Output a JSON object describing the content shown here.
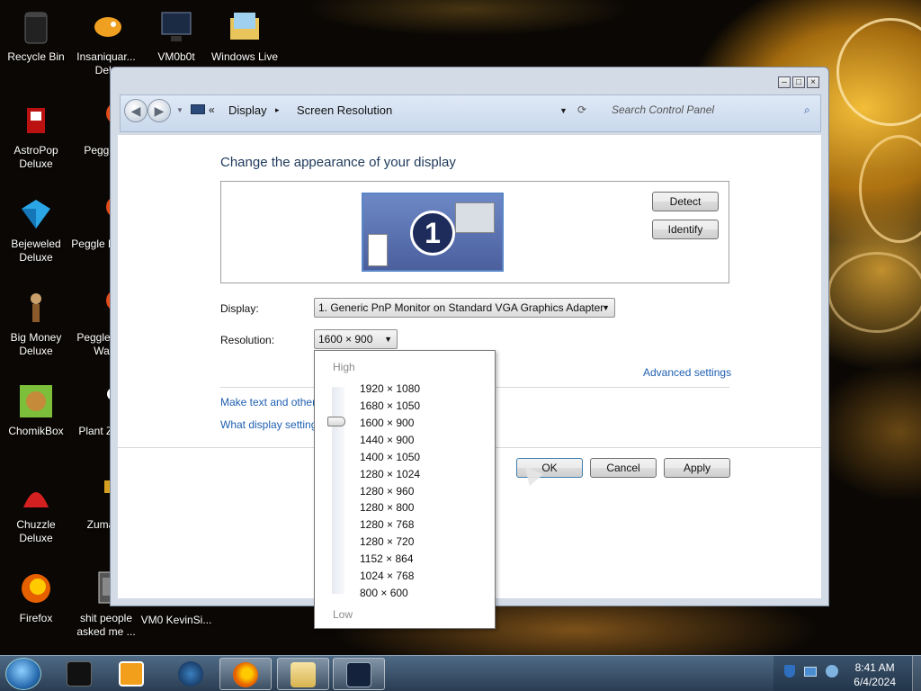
{
  "desktop": {
    "icons": [
      {
        "label": "Recycle Bin"
      },
      {
        "label": "Insaniquar... Delu"
      },
      {
        "label": "VM0b0t"
      },
      {
        "label": "Windows Live"
      },
      {
        "label": "AstroPop Deluxe"
      },
      {
        "label": "Peggle D"
      },
      {
        "label": "Bejeweled Deluxe"
      },
      {
        "label": "Peggle N Delu"
      },
      {
        "label": "Big Money Deluxe"
      },
      {
        "label": "Peggle W of Warc"
      },
      {
        "label": "ChomikBox"
      },
      {
        "label": "Plant Zomb"
      },
      {
        "label": "Chuzzle Deluxe"
      },
      {
        "label": "Zuma D"
      },
      {
        "label": "Firefox"
      },
      {
        "label": "shit people asked me ..."
      },
      {
        "label": "VM0 KevinSi..."
      }
    ]
  },
  "window": {
    "controls": {
      "minimize": "–",
      "maximize": "□",
      "close": "×"
    },
    "breadcrumb": {
      "sep": "«",
      "items": [
        "Display",
        "Screen Resolution"
      ],
      "dot": "▸"
    },
    "search": {
      "placeholder": "Search Control Panel"
    },
    "heading": "Change the appearance of your display",
    "monitor_number": "1",
    "buttons": {
      "detect": "Detect",
      "identify": "Identify",
      "ok": "OK",
      "cancel": "Cancel",
      "apply": "Apply"
    },
    "display": {
      "label": "Display:",
      "value": "1. Generic PnP Monitor on Standard VGA Graphics Adapter"
    },
    "resolution": {
      "label": "Resolution:",
      "value": "1600 × 900"
    },
    "links": {
      "advanced": "Advanced settings",
      "make_text": "Make text and other",
      "what_display": "What display setting"
    }
  },
  "resolution_dropdown": {
    "high_label": "High",
    "low_label": "Low",
    "selected": "1600 × 900",
    "options": [
      "1920 × 1080",
      "1680 × 1050",
      "1600 × 900",
      "1440 × 900",
      "1400 × 1050",
      "1280 × 1024",
      "1280 × 960",
      "1280 × 800",
      "1280 × 768",
      "1280 × 720",
      "1152 × 864",
      "1024 × 768",
      "800 × 600"
    ]
  },
  "taskbar": {
    "clock": {
      "time": "8:41 AM",
      "date": "6/4/2024"
    }
  },
  "colors": {
    "accent": "#1e395b",
    "link": "#1f5fb1",
    "taskbar": "#2a3d52"
  }
}
